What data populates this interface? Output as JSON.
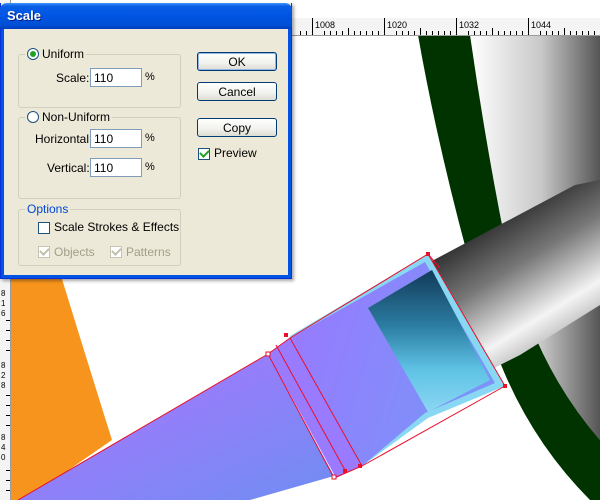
{
  "dialog": {
    "title": "Scale",
    "uniform": {
      "label": "Uniform",
      "selected": true,
      "scale_label": "Scale:",
      "scale_value": "110",
      "unit": "%"
    },
    "non_uniform": {
      "label": "Non-Uniform",
      "selected": false,
      "horizontal_label": "Horizontal:",
      "horizontal_value": "110",
      "vertical_label": "Vertical:",
      "vertical_value": "110",
      "unit": "%"
    },
    "options": {
      "label": "Options",
      "scale_strokes_label": "Scale Strokes & Effects",
      "scale_strokes_checked": false,
      "objects_label": "Objects",
      "objects_checked": true,
      "patterns_label": "Patterns",
      "patterns_checked": true
    },
    "buttons": {
      "ok": "OK",
      "cancel": "Cancel",
      "copy": "Copy"
    },
    "preview": {
      "label": "Preview",
      "checked": true
    }
  },
  "ruler": {
    "top_labels": [
      "1008",
      "1020",
      "1032",
      "1044"
    ],
    "left_labels": [
      "8",
      "1",
      "6",
      "8",
      "2",
      "8",
      "8",
      "4",
      "0"
    ]
  },
  "colors": {
    "accent": "#0054e3",
    "ring_dark_green": "#0a3a0a",
    "orange": "#f7941d",
    "tube_start": "#a77bff",
    "tube_end": "#6a8cf5",
    "selection": "#e8102a"
  }
}
